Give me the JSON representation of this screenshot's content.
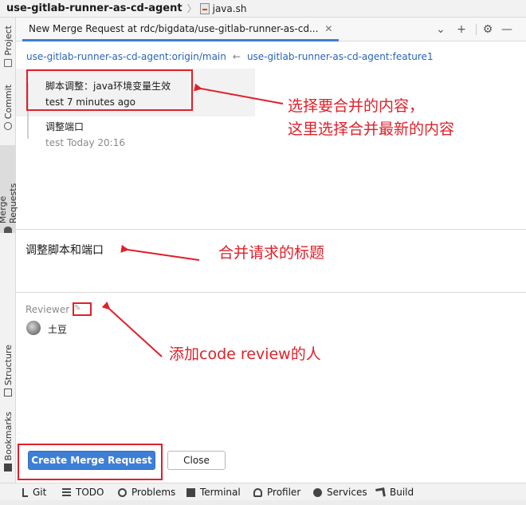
{
  "breadcrumb": {
    "project": "use-gitlab-runner-as-cd-agent",
    "file": "java.sh"
  },
  "left_tabs": [
    "Project",
    "Commit",
    "Merge Requests",
    "Structure",
    "Bookmarks"
  ],
  "panel": {
    "tab_label": "New Merge Request at rdc/bigdata/use-gitlab-runner-as-cd...",
    "actions": [
      "chevron-down-icon",
      "plus-icon",
      "gear-icon",
      "minimize-icon"
    ]
  },
  "branches": {
    "target": "use-gitlab-runner-as-cd-agent:origin/main",
    "arrow": "←",
    "source": "use-gitlab-runner-as-cd-agent:feature1"
  },
  "commits": [
    {
      "title": "脚本调整：java环境变量生效",
      "meta": "test 7 minutes ago"
    },
    {
      "title": "调整端口",
      "meta": "test Today 20:16"
    }
  ],
  "merge_request": {
    "title": "调整脚本和端口"
  },
  "reviewer": {
    "label": "Reviewer",
    "name": "土豆"
  },
  "buttons": {
    "create": "Create Merge Request",
    "close": "Close"
  },
  "bottom_tools": [
    "Git",
    "TODO",
    "Problems",
    "Terminal",
    "Profiler",
    "Services",
    "Build"
  ],
  "annotations": {
    "commits_line1": "选择要合并的内容，",
    "commits_line2": "这里选择合并最新的内容",
    "title": "合并请求的标题",
    "reviewer": "添加code review的人"
  },
  "colors": {
    "accent": "#3d7fd6",
    "link": "#2a64b8",
    "annotation": "#e0202a"
  }
}
